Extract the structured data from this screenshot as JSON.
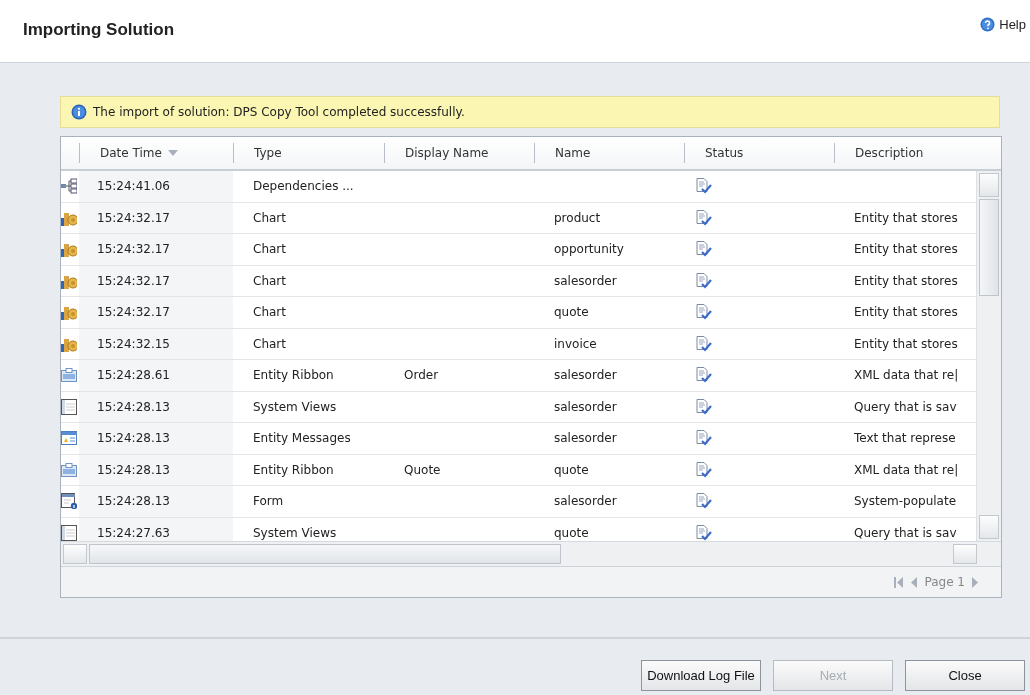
{
  "window": {
    "title": "Importing Solution",
    "help": "Help"
  },
  "message": "The import of solution: DPS Copy Tool completed successfully.",
  "table": {
    "columns": [
      {
        "label": "Date Time",
        "sorted": true
      },
      {
        "label": "Type",
        "sorted": false
      },
      {
        "label": "Display Name",
        "sorted": false
      },
      {
        "label": "Name",
        "sorted": false
      },
      {
        "label": "Status",
        "sorted": false
      },
      {
        "label": "Description",
        "sorted": false
      }
    ],
    "rows": [
      {
        "kind": "dependencies",
        "time": "15:24:41.06",
        "type": "Dependencies ...",
        "display_name": "",
        "name": "",
        "description": ""
      },
      {
        "kind": "chart",
        "time": "15:24:32.17",
        "type": "Chart",
        "name": "product",
        "description": "Entity that stores"
      },
      {
        "kind": "chart",
        "time": "15:24:32.17",
        "type": "Chart",
        "name": "opportunity",
        "description": "Entity that stores"
      },
      {
        "kind": "chart",
        "time": "15:24:32.17",
        "type": "Chart",
        "name": "salesorder",
        "description": "Entity that stores"
      },
      {
        "kind": "chart",
        "time": "15:24:32.17",
        "type": "Chart",
        "name": "quote",
        "description": "Entity that stores"
      },
      {
        "kind": "chart",
        "time": "15:24:32.15",
        "type": "Chart",
        "name": "invoice",
        "description": "Entity that stores"
      },
      {
        "kind": "ribbon",
        "time": "15:24:28.61",
        "type": "Entity Ribbon",
        "display_name": "Order",
        "name": "salesorder",
        "description": "XML data that re|"
      },
      {
        "kind": "view",
        "time": "15:24:28.13",
        "type": "System Views",
        "name": "salesorder",
        "description": "Query that is sav"
      },
      {
        "kind": "messages",
        "time": "15:24:28.13",
        "type": "Entity Messages",
        "name": "salesorder",
        "description": "Text that represe"
      },
      {
        "kind": "ribbon",
        "time": "15:24:28.13",
        "type": "Entity Ribbon",
        "display_name": "Quote",
        "name": "quote",
        "description": "XML data that re|"
      },
      {
        "kind": "form",
        "time": "15:24:28.13",
        "type": "Form",
        "name": "salesorder",
        "description": "System-populate"
      },
      {
        "kind": "view",
        "time": "15:24:27.63",
        "type": "System Views",
        "name": "quote",
        "description": "Query that is sav"
      }
    ]
  },
  "pager": "Page 1",
  "buttons": [
    {
      "label": "Download Log File",
      "disabled": false
    },
    {
      "label": "Next",
      "disabled": true
    },
    {
      "label": "Close",
      "disabled": false
    }
  ]
}
